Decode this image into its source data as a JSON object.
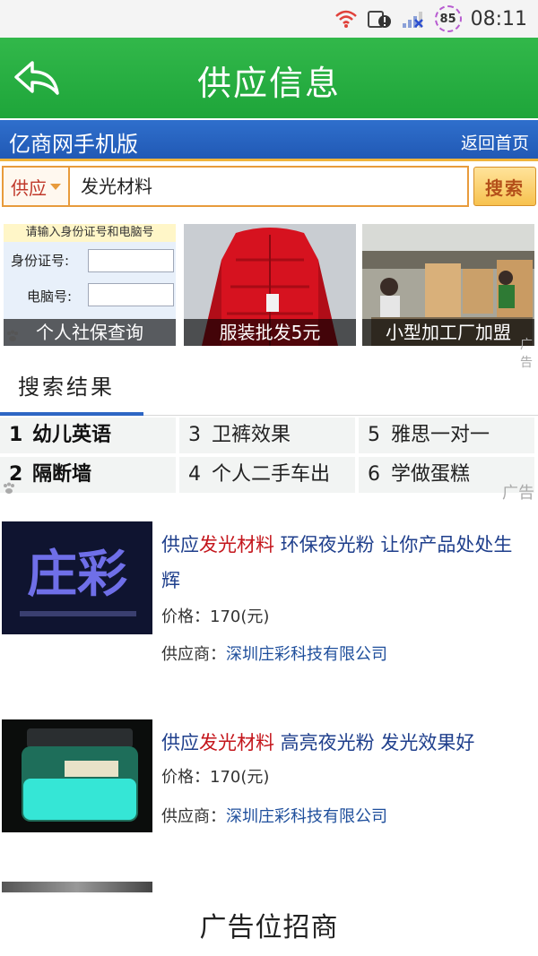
{
  "status_bar": {
    "battery_level": "85",
    "time": "08:11",
    "icons": [
      "wifi-icon",
      "sim-alert-icon",
      "signal-icon",
      "battery-icon"
    ]
  },
  "header": {
    "title": "供应信息",
    "back_icon": "back-arrow-icon"
  },
  "site_bar": {
    "site_name": "亿商网手机版",
    "home_link": "返回首页"
  },
  "search": {
    "type_label": "供应",
    "query": "发光材料",
    "button_label": "搜索"
  },
  "banners": [
    {
      "caption": "个人社保查询",
      "form_header": "请输入身份证号和电脑号",
      "field1_label": "身份证号:",
      "field2_label": "电脑号:"
    },
    {
      "caption": "服装批发5元"
    },
    {
      "caption": "小型加工厂加盟"
    }
  ],
  "ad_label": "广告",
  "results_tab": "搜索结果",
  "hot_searches": [
    {
      "num": "1",
      "text": "幼儿英语",
      "bold": true
    },
    {
      "num": "3",
      "text": "卫裤效果",
      "bold": false
    },
    {
      "num": "5",
      "text": "雅思一对一",
      "bold": false
    },
    {
      "num": "2",
      "text": "隔断墙",
      "bold": true
    },
    {
      "num": "4",
      "text": "个人二手车出",
      "bold": false
    },
    {
      "num": "6",
      "text": "学做蛋糕",
      "bold": false
    }
  ],
  "results": [
    {
      "prefix": "供应",
      "highlight": "发光材料",
      "suffix": " 环保夜光粉 让你产品处处生辉",
      "price": "价格：170(元)",
      "supplier_label": "供应商：",
      "supplier": "深圳庄彩科技有限公司",
      "thumb_text": "庄彩"
    },
    {
      "prefix": "供应",
      "highlight": "发光材料",
      "suffix": " 高亮夜光粉 发光效果好",
      "price": "价格：170(元)",
      "supplier_label": "供应商：",
      "supplier": "深圳庄彩科技有限公司"
    }
  ],
  "footer_ad": "广告位招商",
  "colors": {
    "header_green": "#1ea53a",
    "site_blue": "#2159b5",
    "accent_orange": "#e89b3c",
    "highlight_red": "#c4161c",
    "link_blue": "#1f3f8c"
  }
}
